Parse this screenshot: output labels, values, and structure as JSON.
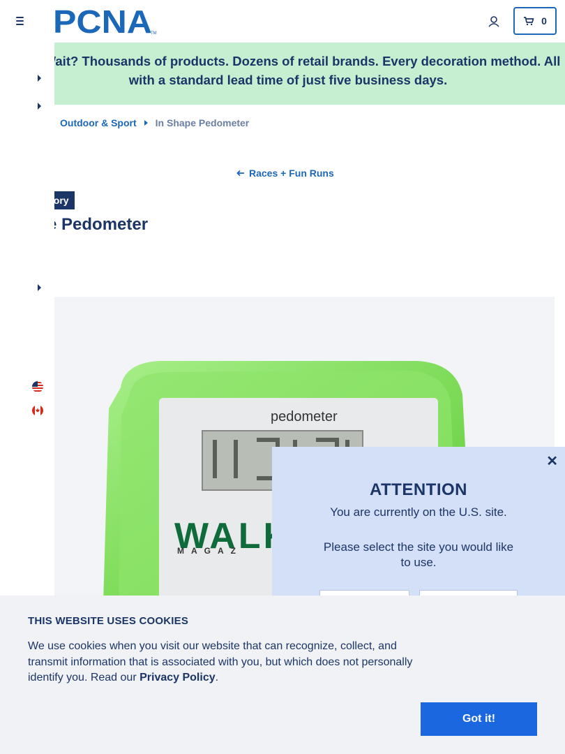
{
  "header": {
    "logo_text": "PCNA",
    "cart_count": "0"
  },
  "banner": {
    "text_line1": "Wait? Thousands of products. Dozens of retail brands. Every decoration method. All",
    "text_line2": "with a standard lead time of just five business days."
  },
  "breadcrumb": {
    "items": [
      "Outdoor & Sport"
    ],
    "current": "In Shape Pedometer"
  },
  "back_link": "Races + Fun Runs",
  "product": {
    "badge": "ventory",
    "title": "ape Pedometer",
    "image_brand_text": "WALK",
    "image_sub_text": "MAGAZ",
    "image_device_text": "pedometer"
  },
  "attention_popup": {
    "title": "ATTENTION",
    "line1": "You are currently on the U.S. site.",
    "line2": "Please select the site you would like to use."
  },
  "cookie_banner": {
    "title": "THIS WEBSITE USES COOKIES",
    "text": "We use cookies when you visit our website that can recognize, collect, and transmit information that is associated with you, but which does not personally identify you. Read our ",
    "link": "Privacy Policy",
    "text_end": ".",
    "button": "Got it!"
  },
  "colors": {
    "navy": "#1b3567",
    "blue": "#1b67b8",
    "banner_green": "#c6efd1",
    "popup_blue": "#d3e0f7",
    "button_blue": "#1b67e0",
    "product_green": "#7fdc5a"
  }
}
